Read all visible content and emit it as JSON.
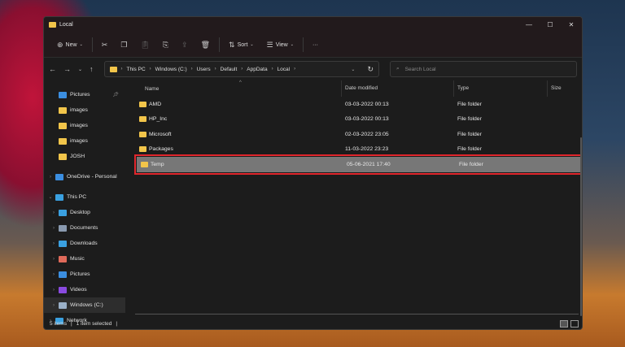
{
  "window": {
    "title": "Local"
  },
  "toolbar": {
    "new": "New",
    "sort": "Sort",
    "view": "View",
    "more": "···"
  },
  "address": {
    "crumbs": [
      "This PC",
      "Windows (C:)",
      "Users",
      "Default",
      "AppData",
      "Local"
    ],
    "search_placeholder": "Search Local"
  },
  "sidebar": {
    "items": [
      {
        "label": "Pictures",
        "color": "#3b8ee0"
      },
      {
        "label": "images",
        "color": "#f2c54a"
      },
      {
        "label": "images",
        "color": "#f2c54a"
      },
      {
        "label": "images",
        "color": "#f2c54a"
      },
      {
        "label": "JOSH",
        "color": "#f2c54a"
      },
      {
        "label": "OneDrive - Personal",
        "color": "#3b8ee0"
      },
      {
        "label": "This PC",
        "color": "#3aa0e0"
      },
      {
        "label": "Desktop",
        "color": "#3aa0e0"
      },
      {
        "label": "Documents",
        "color": "#8a9ab0"
      },
      {
        "label": "Downloads",
        "color": "#3aa0e0"
      },
      {
        "label": "Music",
        "color": "#e06a5a"
      },
      {
        "label": "Pictures",
        "color": "#3b8ee0"
      },
      {
        "label": "Videos",
        "color": "#8a4ae0"
      },
      {
        "label": "Windows (C:)",
        "color": "#9ab0c8"
      },
      {
        "label": "Network",
        "color": "#3aa0e0"
      }
    ]
  },
  "columns": {
    "name": "Name",
    "date": "Date modified",
    "type": "Type",
    "size": "Size"
  },
  "files": [
    {
      "name": "AMD",
      "date": "03-03-2022 00:13",
      "type": "File folder"
    },
    {
      "name": "HP_Inc",
      "date": "03-03-2022 00:13",
      "type": "File folder"
    },
    {
      "name": "Microsoft",
      "date": "02-03-2022 23:05",
      "type": "File folder"
    },
    {
      "name": "Packages",
      "date": "11-03-2022 23:23",
      "type": "File folder"
    },
    {
      "name": "Temp",
      "date": "05-06-2021 17:40",
      "type": "File folder"
    }
  ],
  "status": {
    "count": "5 items",
    "selected": "1 item selected"
  }
}
